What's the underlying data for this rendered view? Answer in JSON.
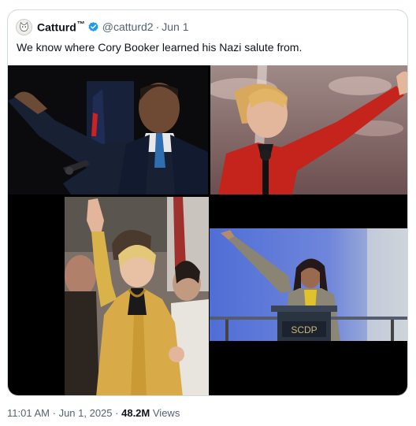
{
  "tweet": {
    "display_name": "Catturd",
    "tm": "™",
    "handle": "@catturd2",
    "separator": "·",
    "date": "Jun 1",
    "text": "We know where Cory Booker learned his Nazi salute from.",
    "verified_color": "#1d9bf0"
  },
  "media": {
    "photos": [
      {
        "subject": "man in dark suit raising right arm at podium"
      },
      {
        "subject": "woman in red jacket raising arm"
      },
      {
        "subject": "woman in yellow jacket waving raised hand"
      },
      {
        "subject": "woman in gray suit raising arm at podium"
      }
    ],
    "podium_sign": "SCDP"
  },
  "meta": {
    "time": "11:01 AM",
    "date": "Jun 1, 2025",
    "views_count": "48.2M",
    "views_label": "Views"
  }
}
